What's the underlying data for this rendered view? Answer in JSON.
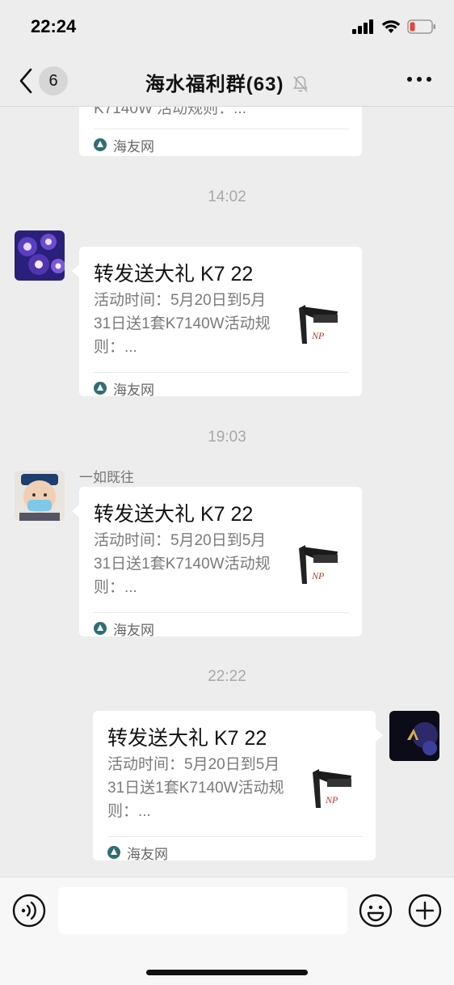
{
  "status_bar": {
    "time": "22:24"
  },
  "nav": {
    "unread_count": "6",
    "title": "海水福利群(63)"
  },
  "messages": [
    {
      "type": "card_partial",
      "desc_last_line": "K7140W 活动规则：...",
      "source": "海友网"
    },
    {
      "type": "time",
      "text": "14:02"
    },
    {
      "type": "card",
      "side": "left",
      "sender": "",
      "title": "转发送大礼 K7 22",
      "desc": "活动时间：5月20日到5月31日送1套K7140W活动规则：...",
      "source": "海友网"
    },
    {
      "type": "time",
      "text": "19:03"
    },
    {
      "type": "card",
      "side": "left",
      "sender": "一如既往",
      "title": "转发送大礼 K7 22",
      "desc": "活动时间：5月20日到5月31日送1套K7140W活动规则：...",
      "source": "海友网"
    },
    {
      "type": "time",
      "text": "22:22"
    },
    {
      "type": "card",
      "side": "right",
      "sender": "",
      "title": "转发送大礼 K7 22",
      "desc": "活动时间：5月20日到5月31日送1套K7140W活动规则：...",
      "source": "海友网"
    }
  ],
  "input_bar": {
    "placeholder": ""
  },
  "icons": {
    "back": "chevron-left-icon",
    "mute": "bell-slash-icon",
    "more": "more-dots-icon",
    "voice": "voice-icon",
    "emoji": "emoji-icon",
    "plus": "plus-icon"
  },
  "colors": {
    "background": "#ededed",
    "bubble": "#ffffff",
    "time_text": "#a8a8a8"
  }
}
